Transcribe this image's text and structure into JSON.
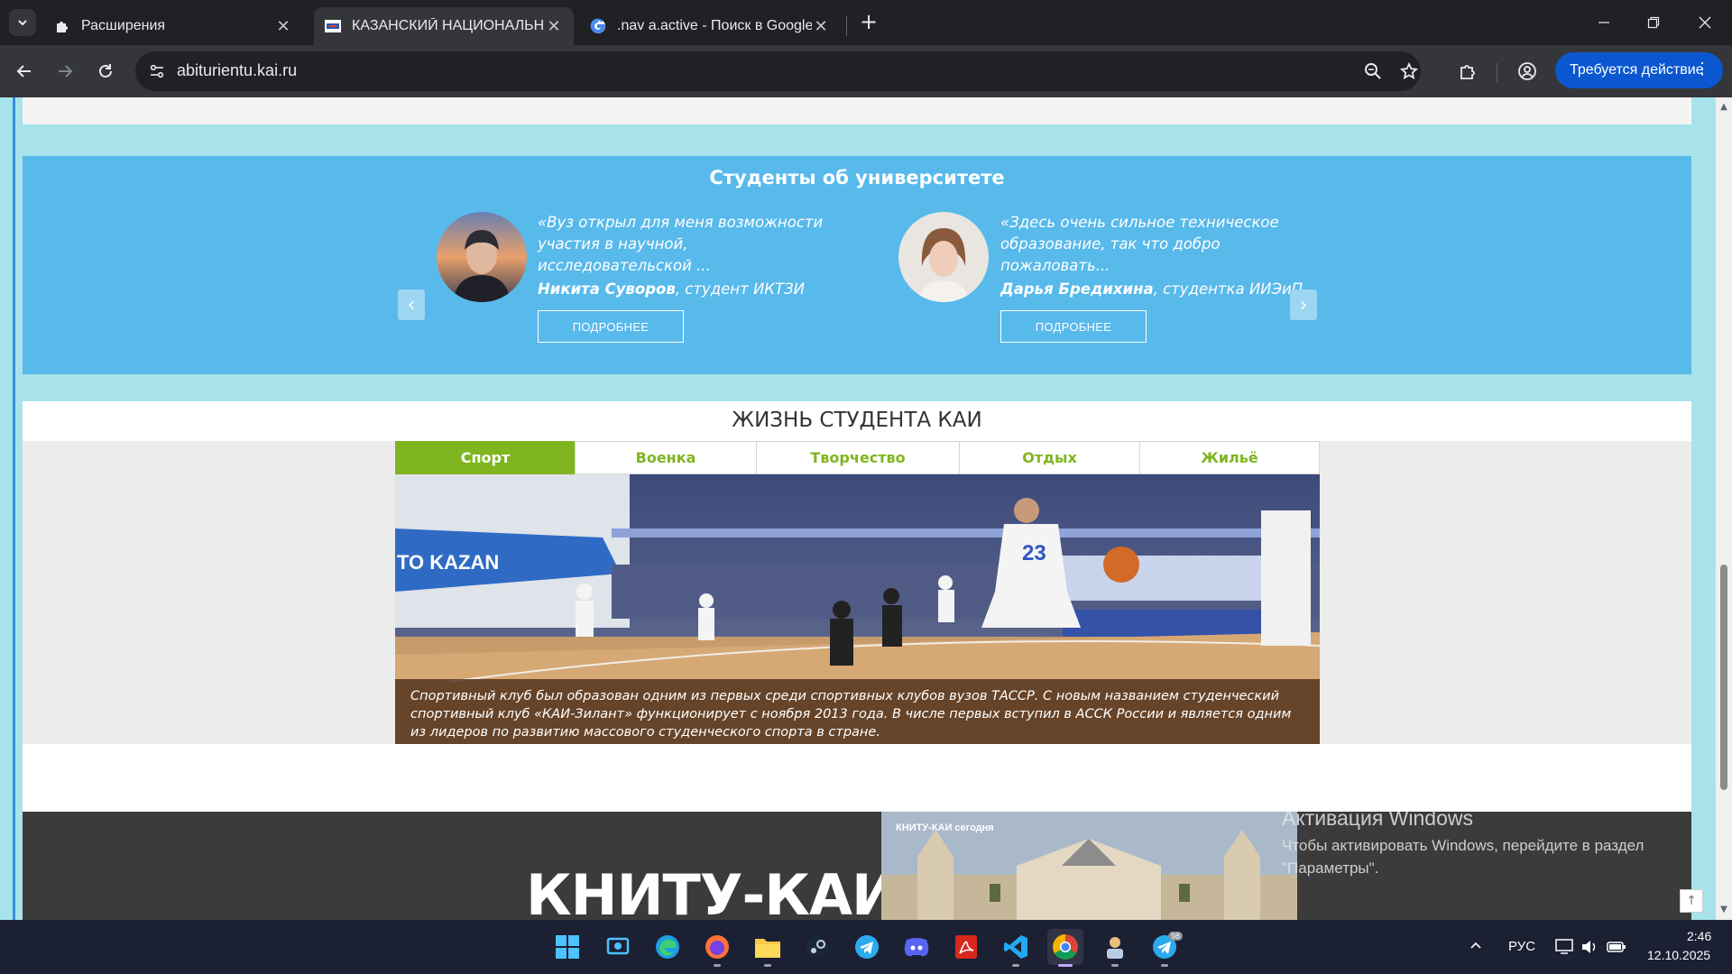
{
  "browser": {
    "tabs": [
      {
        "title": "Расширения",
        "close": "✕"
      },
      {
        "title": "КАЗАНСКИЙ НАЦИОНАЛЬНЫЙ",
        "close": "✕"
      },
      {
        "title": ".nav a.active - Поиск в Google",
        "close": "✕"
      }
    ],
    "new_tab": "+",
    "url": "abiturientu.kai.ru",
    "action_button": "Требуется действие"
  },
  "page": {
    "testimonials": {
      "heading": "Студенты об университете",
      "items": [
        {
          "quote": "«Вуз открыл для меня возможности участия в научной, исследовательской ...",
          "name": "Никита Суворов",
          "role": ", студент ИКТЗИ",
          "button": "ПОДРОБНЕЕ"
        },
        {
          "quote": "«Здесь очень сильное техническое образование, так что добро пожаловать...",
          "name": "Дарья Бредихина",
          "role": ", студентка ИИЭиП",
          "button": "ПОДРОБНЕЕ"
        }
      ],
      "prev_arrow": "‹",
      "next_arrow": "›"
    },
    "student_life": {
      "title": "ЖИЗНЬ СТУДЕНТА КАИ",
      "tabs": [
        "Спорт",
        "Военка",
        "Творчество",
        "Отдых",
        "Жильё"
      ],
      "active_tab": "Спорт",
      "caption": "Спортивный клуб был образован одним из первых среди спортивных клубов вузов ТАССР. С новым названием студенческий спортивный клуб «КАИ-Зилант» функционирует с ноября 2013 года. В числе первых вступил в АССК России и является одним из лидеров по развитию массового студенческого спорта в стране.",
      "image_text": "TO KAZAN",
      "jersey_number": "23"
    },
    "footer": {
      "logo_text": "КНИТУ-КАИ",
      "photo_label": "КНИТУ-КАИ сегодня"
    },
    "to_top": "↑"
  },
  "windows_activation": {
    "title": "Активация Windows",
    "text": "Чтобы активировать Windows, перейдите в раздел \"Параметры\"."
  },
  "taskbar": {
    "language": "РУС",
    "time": "2:46",
    "date": "12.10.2025",
    "telegram_badge": "98"
  },
  "colors": {
    "accent_green": "#7fb51f",
    "testimonial_blue": "#58b9eb",
    "page_bg": "#a8e3ec",
    "chrome_action": "#0b57d0"
  }
}
